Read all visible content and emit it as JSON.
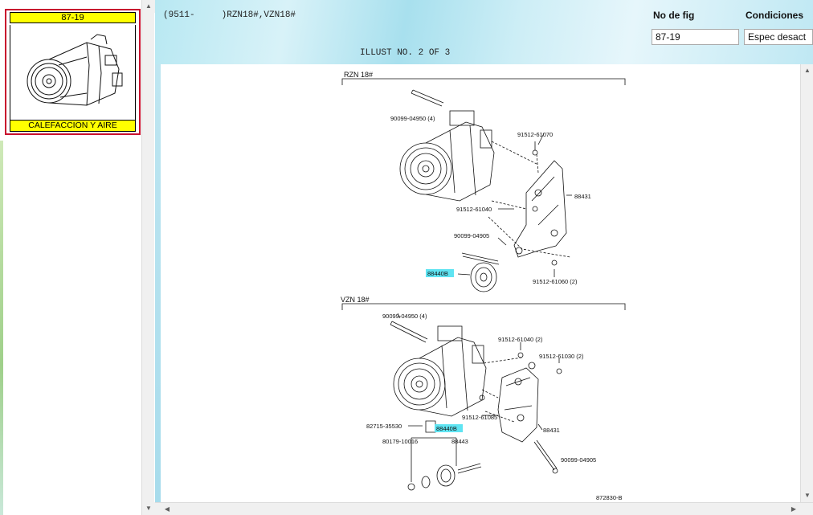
{
  "left_panel": {
    "thumb_title": "87-19",
    "thumb_caption": "CALEFACCION Y AIRE",
    "scroll_up_glyph": "▲",
    "scroll_down_glyph": "▼"
  },
  "header": {
    "catalog_range": "(9511-     )RZN18#,VZN18#",
    "illust_no": "ILLUST NO. 2 OF 3",
    "fig_label": "No de fig",
    "fig_value": "87-19",
    "cond_label": "Condiciones",
    "cond_value": "Espec desact"
  },
  "diagram": {
    "section_rzn": "RZN 18#",
    "section_vzn": "VZN 18#",
    "rzn_parts": {
      "bolt_top": "90099-04950 (4)",
      "nut_a": "91512-61070",
      "bracket": "88431",
      "bolt_mid": "91512-61040",
      "bolt_low": "90099-04905",
      "pulley": "88440B",
      "nut_b": "91512-61060 (2)"
    },
    "vzn_parts": {
      "bolt_top": "90099-04950 (4)",
      "bolt_a": "91512-61040 (2)",
      "bolt_b": "91512-61030 (2)",
      "bolt_c": "91512-61085",
      "bracket": "88431",
      "bracket_small": "82715-35530",
      "pulley": "88440B",
      "washer": "80179-10016",
      "spacer": "88443",
      "bolt_low": "90099-04905"
    },
    "drawing_number": "872830-B"
  },
  "scrollbars": {
    "up_glyph": "▲",
    "down_glyph": "▼",
    "left_glyph": "◀",
    "right_glyph": "▶"
  },
  "colors": {
    "highlight": "#5fe4f2",
    "thumb_bg": "#ffff00",
    "thumb_border": "#c8102e"
  }
}
